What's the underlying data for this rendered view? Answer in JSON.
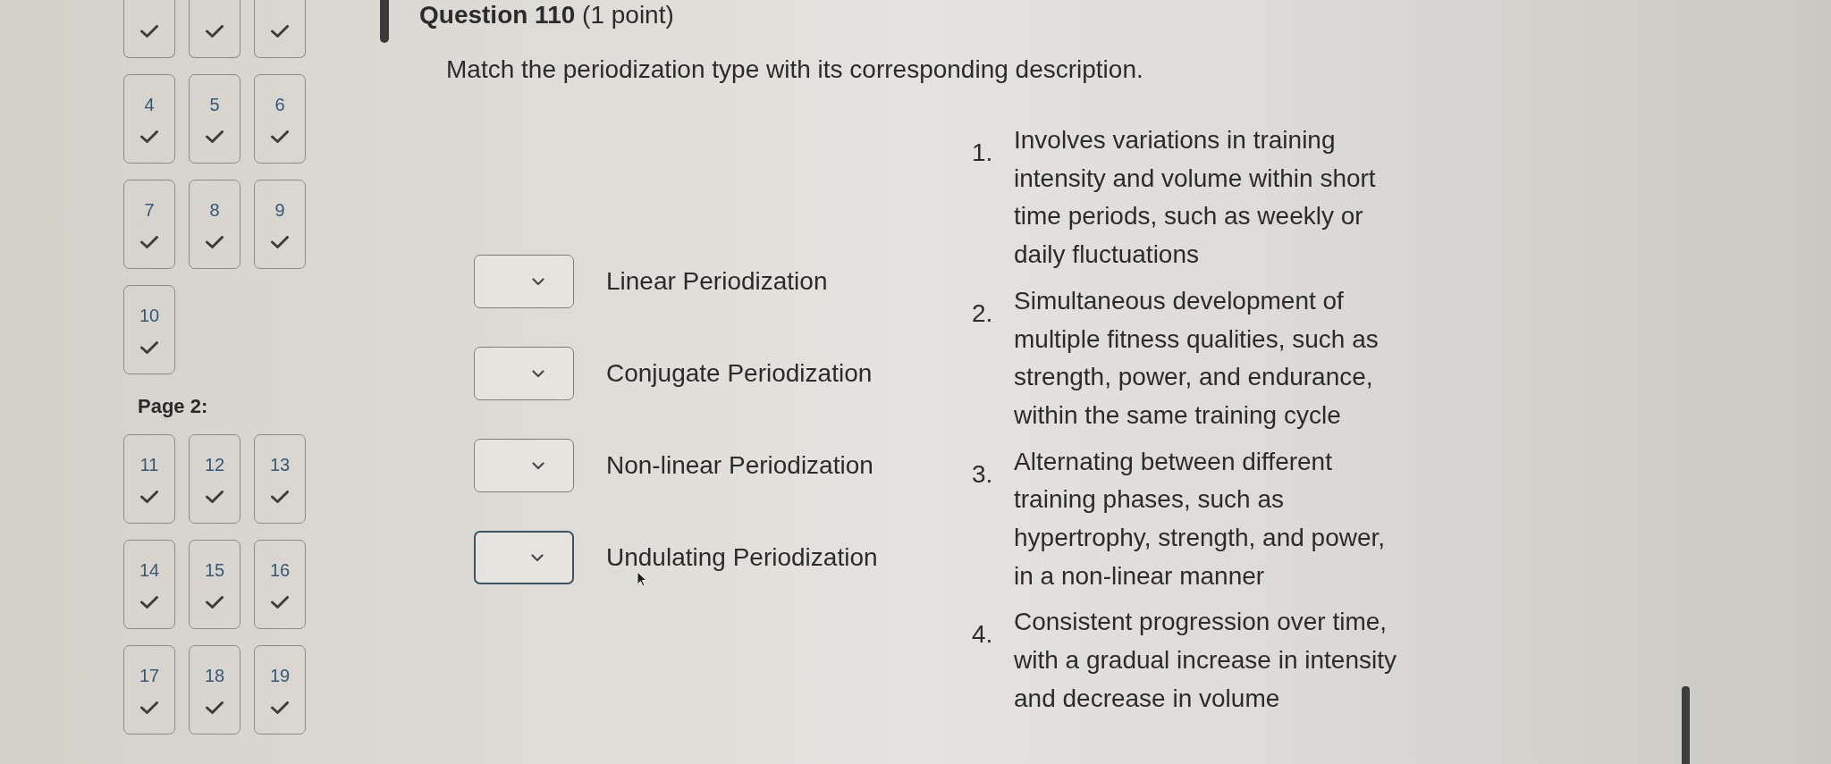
{
  "navigation": {
    "sections": [
      {
        "question_tiles": [
          {
            "answered": true
          },
          {
            "answered": true
          },
          {
            "answered": true
          },
          {
            "number": "4",
            "answered": true
          },
          {
            "number": "5",
            "answered": true
          },
          {
            "number": "6",
            "answered": true
          },
          {
            "number": "7",
            "answered": true
          },
          {
            "number": "8",
            "answered": true
          },
          {
            "number": "9",
            "answered": true
          },
          {
            "number": "10",
            "answered": true
          }
        ]
      },
      {
        "label": "Page 2:",
        "question_tiles": [
          {
            "number": "11",
            "answered": true
          },
          {
            "number": "12",
            "answered": true
          },
          {
            "number": "13",
            "answered": true
          },
          {
            "number": "14",
            "answered": true
          },
          {
            "number": "15",
            "answered": true
          },
          {
            "number": "16",
            "answered": true
          },
          {
            "number": "17",
            "answered": true
          },
          {
            "number": "18",
            "answered": true
          },
          {
            "number": "19",
            "answered": true
          }
        ]
      }
    ]
  },
  "question": {
    "title": "**Question 110** (1 point)",
    "prompt": "Match the periodization type with its corresponding description."
  },
  "matching": {
    "items": [
      {
        "label": "Linear Periodization",
        "hovered": false
      },
      {
        "label": "Conjugate Periodization",
        "hovered": false
      },
      {
        "label": "Non-linear Periodization",
        "hovered": false
      },
      {
        "label": "Undulating Periodization",
        "hovered": true
      }
    ],
    "choices": [
      {
        "number": "1.",
        "text": "Involves variations in training intensity and volume within short time periods, such as weekly or daily fluctuations"
      },
      {
        "number": "2.",
        "text": "Simultaneous development of multiple fitness qualities, such as strength, power, and endurance, within the same training cycle"
      },
      {
        "number": "3.",
        "text": "Alternating between different training phases, such as hypertrophy, strength, and power, in a non-linear manner"
      },
      {
        "number": "4.",
        "text": "Consistent progression over time, with a gradual increase in intensity and decrease in volume"
      }
    ]
  }
}
